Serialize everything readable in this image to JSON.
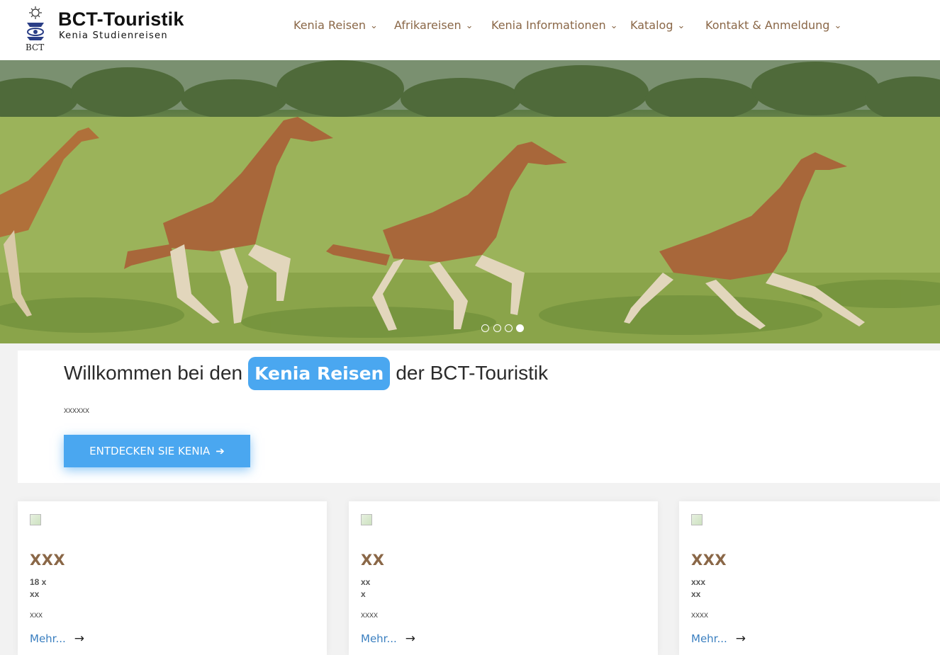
{
  "brand": {
    "title": "BCT-Touristik",
    "subtitle": "Kenia Studienreisen",
    "logo_icon": "bct-logo-icon",
    "logo_text": "BCT"
  },
  "nav": {
    "items": [
      {
        "label": "Kenia Reisen"
      },
      {
        "label": "Afrikareisen"
      },
      {
        "label": "Kenia Informationen"
      },
      {
        "label": "Katalog"
      },
      {
        "label": "Kontakt & Anmeldung"
      }
    ],
    "chevron": "⌄"
  },
  "hero": {
    "image": "running-giraffes-savanna",
    "slides": 4,
    "active_slide": 4
  },
  "welcome": {
    "heading_before": "Willkommen bei den",
    "heading_highlight": "Kenia Reisen",
    "heading_after": "der BCT-Touristik",
    "text": "xxxxxx",
    "cta_label": "ENTDECKEN SIE KENIA",
    "cta_arrow": "➔"
  },
  "cards": [
    {
      "title": "XXX",
      "meta1": "18 x",
      "meta2": "xx",
      "desc": "xxx",
      "link": "Mehr...",
      "link_arrow": "→"
    },
    {
      "title": "XX",
      "meta1": "xx",
      "meta2": "x",
      "desc": "xxxx",
      "link": "Mehr...",
      "link_arrow": "→"
    },
    {
      "title": "XXX",
      "meta1": "xxx",
      "meta2": "xx",
      "desc": "xxxx",
      "link": "Mehr...",
      "link_arrow": "→"
    }
  ],
  "colors": {
    "accent": "#4aa7f0",
    "nav_text": "#8a6747",
    "link": "#3a7fc0"
  }
}
